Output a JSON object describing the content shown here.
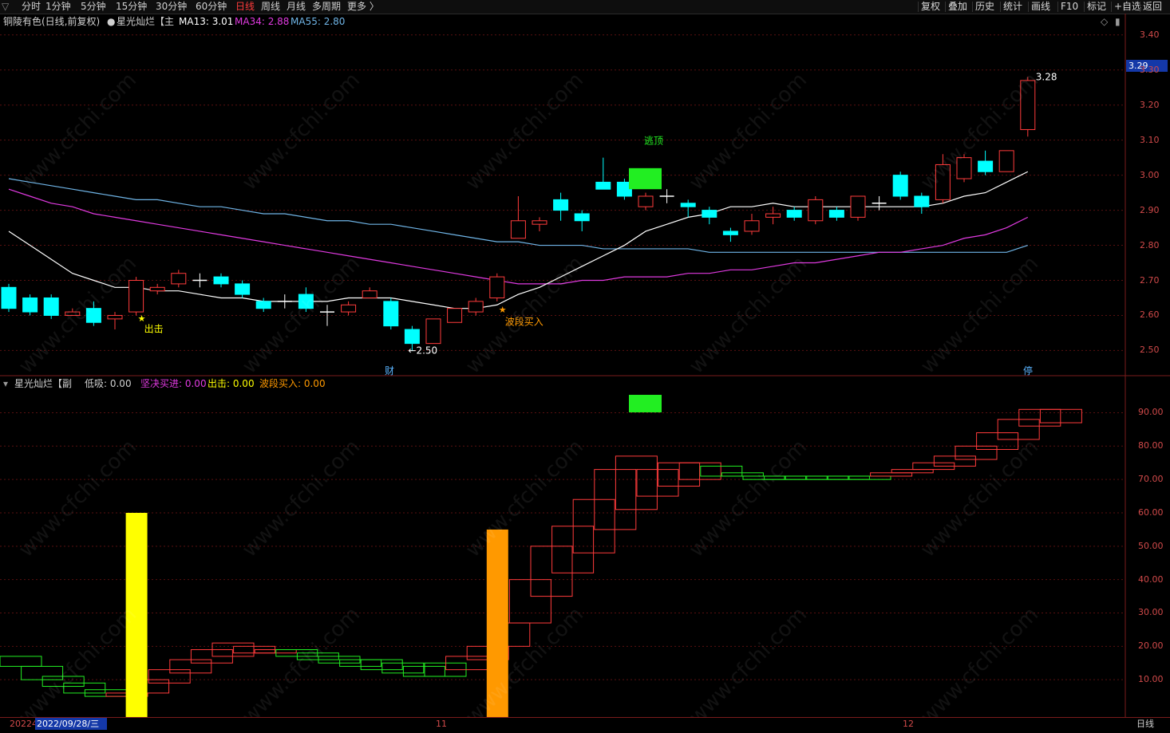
{
  "toolbar": {
    "menu_icon": "▽",
    "periods": [
      {
        "label": "分时",
        "active": false
      },
      {
        "label": "1分钟",
        "active": false
      },
      {
        "label": "5分钟",
        "active": false
      },
      {
        "label": "15分钟",
        "active": false
      },
      {
        "label": "30分钟",
        "active": false
      },
      {
        "label": "60分钟",
        "active": false
      },
      {
        "label": "日线",
        "active": true
      },
      {
        "label": "周线",
        "active": false
      },
      {
        "label": "月线",
        "active": false
      },
      {
        "label": "多周期",
        "active": false
      },
      {
        "label": "更多 〉",
        "active": false
      }
    ],
    "right": [
      "复权",
      "叠加",
      "历史",
      "统计",
      "画线",
      "F10",
      "标记",
      "+自选",
      "返回"
    ]
  },
  "main_header": {
    "stock": "铜陵有色(日线,前复权)",
    "indicator": "星光灿烂【主",
    "ma13": "MA13: 3.01",
    "ma34": "MA34: 2.88",
    "ma55": "MA55: 2.80"
  },
  "sub_header": {
    "indicator": "星光灿烂【副",
    "dixi": "低吸: 0.00",
    "jianjue": "坚决买进: 0.00",
    "chuji": "出击: 0.00",
    "boduan": "波段买入: 0.00"
  },
  "colors": {
    "up": "#ff3b3b",
    "down": "#00ffff",
    "ma13": "#ffffff",
    "ma34": "#e03ae0",
    "ma55": "#6fb4e6",
    "axis": "#d24a4a",
    "green": "#22ee22",
    "yellow": "#ffff00",
    "orange": "#ff9900"
  },
  "main_axis": {
    "ticks": [
      "3.40",
      "3.30",
      "3.20",
      "3.10",
      "3.00",
      "2.90",
      "2.80",
      "2.70",
      "2.60",
      "2.50"
    ],
    "current": "3.29"
  },
  "sub_axis": {
    "ticks": [
      "90.00",
      "80.00",
      "70.00",
      "60.00",
      "50.00",
      "40.00",
      "30.00",
      "20.00",
      "10.00"
    ]
  },
  "annotations": {
    "chuji": "出击",
    "boduan": "波段买入",
    "taoding": "逃顶",
    "low": "←2.50",
    "high": "3.28",
    "cai1": "财",
    "cai2": "停"
  },
  "dates": {
    "first": "20224",
    "cursor": "2022/09/28/三",
    "m11": "11",
    "m12": "12",
    "period": "日线"
  },
  "watermark": "www.cfchi.com",
  "chart_data": {
    "type": "candlestick",
    "title": "铜陵有色(日线,前复权)",
    "ylim": [
      2.46,
      3.42
    ],
    "candles": [
      [
        2.68,
        2.62,
        2.69,
        2.61
      ],
      [
        2.65,
        2.61,
        2.66,
        2.6
      ],
      [
        2.65,
        2.6,
        2.66,
        2.59
      ],
      [
        2.6,
        2.61,
        2.62,
        2.6
      ],
      [
        2.62,
        2.58,
        2.64,
        2.57
      ],
      [
        2.59,
        2.6,
        2.61,
        2.56
      ],
      [
        2.61,
        2.7,
        2.71,
        2.6
      ],
      [
        2.67,
        2.68,
        2.69,
        2.66
      ],
      [
        2.69,
        2.72,
        2.73,
        2.68
      ],
      [
        2.7,
        2.7,
        2.72,
        2.68
      ],
      [
        2.71,
        2.69,
        2.72,
        2.68
      ],
      [
        2.69,
        2.66,
        2.7,
        2.65
      ],
      [
        2.64,
        2.62,
        2.65,
        2.61
      ],
      [
        2.64,
        2.64,
        2.66,
        2.62
      ],
      [
        2.66,
        2.62,
        2.68,
        2.61
      ],
      [
        2.61,
        2.61,
        2.63,
        2.57
      ],
      [
        2.61,
        2.63,
        2.64,
        2.6
      ],
      [
        2.65,
        2.67,
        2.68,
        2.65
      ],
      [
        2.64,
        2.57,
        2.65,
        2.56
      ],
      [
        2.56,
        2.52,
        2.57,
        2.5
      ],
      [
        2.52,
        2.59,
        2.59,
        2.52
      ],
      [
        2.58,
        2.62,
        2.62,
        2.58
      ],
      [
        2.61,
        2.64,
        2.65,
        2.6
      ],
      [
        2.65,
        2.71,
        2.72,
        2.64
      ],
      [
        2.82,
        2.87,
        2.94,
        2.82
      ],
      [
        2.86,
        2.87,
        2.88,
        2.84
      ],
      [
        2.93,
        2.9,
        2.95,
        2.87
      ],
      [
        2.89,
        2.87,
        2.9,
        2.84
      ],
      [
        2.98,
        2.96,
        3.05,
        2.96
      ],
      [
        2.98,
        2.94,
        2.99,
        2.93
      ],
      [
        2.91,
        2.94,
        2.95,
        2.9
      ],
      [
        2.94,
        2.94,
        2.96,
        2.92
      ],
      [
        2.92,
        2.91,
        2.93,
        2.88
      ],
      [
        2.9,
        2.88,
        2.91,
        2.86
      ],
      [
        2.84,
        2.83,
        2.85,
        2.81
      ],
      [
        2.84,
        2.87,
        2.89,
        2.83
      ],
      [
        2.88,
        2.89,
        2.91,
        2.86
      ],
      [
        2.9,
        2.88,
        2.91,
        2.87
      ],
      [
        2.87,
        2.93,
        2.94,
        2.86
      ],
      [
        2.9,
        2.88,
        2.91,
        2.87
      ],
      [
        2.88,
        2.94,
        2.94,
        2.87
      ],
      [
        2.92,
        2.92,
        2.94,
        2.9
      ],
      [
        3.0,
        2.94,
        3.01,
        2.93
      ],
      [
        2.94,
        2.91,
        2.95,
        2.89
      ],
      [
        2.93,
        3.03,
        3.06,
        2.92
      ],
      [
        2.99,
        3.05,
        3.06,
        2.98
      ],
      [
        3.04,
        3.01,
        3.07,
        3.0
      ],
      [
        3.01,
        3.07,
        3.07,
        3.01
      ],
      [
        3.13,
        3.27,
        3.28,
        3.11
      ]
    ],
    "ma13": [
      2.84,
      2.8,
      2.76,
      2.72,
      2.7,
      2.68,
      2.68,
      2.67,
      2.67,
      2.66,
      2.65,
      2.65,
      2.64,
      2.64,
      2.64,
      2.64,
      2.65,
      2.65,
      2.65,
      2.64,
      2.63,
      2.62,
      2.62,
      2.63,
      2.66,
      2.68,
      2.71,
      2.74,
      2.77,
      2.8,
      2.84,
      2.86,
      2.88,
      2.89,
      2.91,
      2.91,
      2.92,
      2.91,
      2.91,
      2.91,
      2.91,
      2.91,
      2.91,
      2.91,
      2.92,
      2.94,
      2.95,
      2.98,
      3.01
    ],
    "ma34": [
      2.96,
      2.94,
      2.92,
      2.91,
      2.89,
      2.88,
      2.87,
      2.86,
      2.85,
      2.84,
      2.83,
      2.82,
      2.81,
      2.8,
      2.79,
      2.78,
      2.77,
      2.76,
      2.75,
      2.74,
      2.73,
      2.72,
      2.71,
      2.7,
      2.69,
      2.69,
      2.69,
      2.7,
      2.7,
      2.71,
      2.71,
      2.71,
      2.72,
      2.72,
      2.73,
      2.73,
      2.74,
      2.75,
      2.75,
      2.76,
      2.77,
      2.78,
      2.78,
      2.79,
      2.8,
      2.82,
      2.83,
      2.85,
      2.88
    ],
    "ma55": [
      2.99,
      2.98,
      2.97,
      2.96,
      2.95,
      2.94,
      2.93,
      2.93,
      2.92,
      2.91,
      2.91,
      2.9,
      2.89,
      2.89,
      2.88,
      2.87,
      2.87,
      2.86,
      2.86,
      2.85,
      2.84,
      2.83,
      2.82,
      2.81,
      2.81,
      2.8,
      2.8,
      2.8,
      2.79,
      2.79,
      2.79,
      2.79,
      2.79,
      2.78,
      2.78,
      2.78,
      2.78,
      2.78,
      2.78,
      2.78,
      2.78,
      2.78,
      2.78,
      2.78,
      2.78,
      2.78,
      2.78,
      2.78,
      2.8
    ],
    "sub_ylim": [
      0,
      98
    ],
    "sub_boxes": [
      [
        14,
        17
      ],
      [
        10,
        14
      ],
      [
        8,
        11
      ],
      [
        6,
        9
      ],
      [
        5,
        7
      ],
      [
        5,
        6
      ],
      [
        6,
        10
      ],
      [
        9,
        13
      ],
      [
        12,
        16
      ],
      [
        15,
        19
      ],
      [
        17,
        21
      ],
      [
        18,
        20
      ],
      [
        18,
        19
      ],
      [
        17,
        19
      ],
      [
        16,
        18
      ],
      [
        15,
        17
      ],
      [
        14,
        16
      ],
      [
        13,
        16
      ],
      [
        12,
        15
      ],
      [
        11,
        14
      ],
      [
        11,
        15
      ],
      [
        13,
        17
      ],
      [
        16,
        20
      ],
      [
        20,
        27
      ],
      [
        27,
        40
      ],
      [
        35,
        50
      ],
      [
        42,
        56
      ],
      [
        48,
        64
      ],
      [
        55,
        73
      ],
      [
        61,
        77
      ],
      [
        65,
        73
      ],
      [
        68,
        75
      ],
      [
        70,
        75
      ],
      [
        71,
        74
      ],
      [
        71,
        72
      ],
      [
        70,
        71
      ],
      [
        70,
        71
      ],
      [
        70,
        71
      ],
      [
        70,
        71
      ],
      [
        70,
        71
      ],
      [
        70,
        71
      ],
      [
        71,
        72
      ],
      [
        72,
        73
      ],
      [
        73,
        75
      ],
      [
        74,
        77
      ],
      [
        76,
        80
      ],
      [
        79,
        84
      ],
      [
        82,
        88
      ],
      [
        86,
        91
      ],
      [
        87,
        91
      ]
    ],
    "sub_green_idx": [
      0,
      1,
      2,
      3,
      4,
      13,
      14,
      15,
      16,
      17,
      18,
      19,
      20,
      33,
      34,
      35,
      36,
      37,
      38,
      39,
      40
    ],
    "bars": [
      {
        "name": "出击",
        "index": 6,
        "value": 60,
        "color": "yellow"
      },
      {
        "name": "波段买入",
        "index": 23,
        "value": 55,
        "color": "orange"
      }
    ]
  }
}
